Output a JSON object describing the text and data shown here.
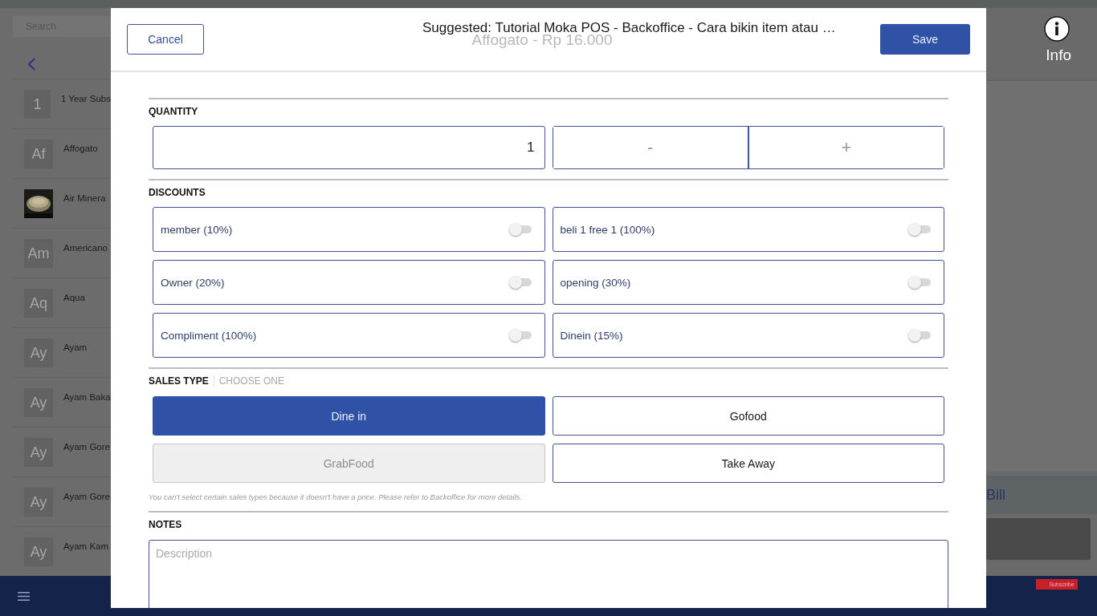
{
  "background_app": {
    "search": {
      "placeholder": "Search"
    },
    "items": [
      {
        "name": "1 Year Subs",
        "kind": "letters",
        "initials": "1"
      },
      {
        "name": "Affogato",
        "kind": "letters",
        "initials": "Af"
      },
      {
        "name": "Air Minera",
        "kind": "picture"
      },
      {
        "name": "Americano",
        "kind": "letters",
        "initials": "Am"
      },
      {
        "name": "Aqua",
        "kind": "letters",
        "initials": "Aq"
      },
      {
        "name": "Ayam",
        "kind": "letters",
        "initials": "Ay"
      },
      {
        "name": "Ayam Baka",
        "kind": "letters",
        "initials": "Ay"
      },
      {
        "name": "Ayam Gore",
        "kind": "letters",
        "initials": "Ay"
      },
      {
        "name": "Ayam Gore",
        "kind": "letters",
        "initials": "Ay"
      },
      {
        "name": "Ayam Kam",
        "kind": "letters",
        "initials": "Ay"
      }
    ],
    "bill_label": "Bill"
  },
  "modal": {
    "title": "Affogato - Rp 16.000",
    "cancel": "Cancel",
    "save": "Save",
    "quantity": {
      "label": "QUANTITY",
      "value": "1",
      "minus": "-",
      "plus": "+"
    },
    "discounts": {
      "label": "DISCOUNTS",
      "items": [
        {
          "name": "member (10%)",
          "on": false
        },
        {
          "name": "beli 1 free 1 (100%)",
          "on": false
        },
        {
          "name": "Owner (20%)",
          "on": false
        },
        {
          "name": "opening (30%)",
          "on": false
        },
        {
          "name": "Compliment (100%)",
          "on": false
        },
        {
          "name": "Dinein (15%)",
          "on": false
        }
      ]
    },
    "sales_type": {
      "label": "SALES TYPE",
      "sublabel": "CHOOSE ONE",
      "options": [
        {
          "label": "Dine in",
          "selected": true,
          "disabled": false
        },
        {
          "label": "Gofood",
          "selected": false,
          "disabled": false
        },
        {
          "label": "GrabFood",
          "selected": false,
          "disabled": true
        },
        {
          "label": "Take Away",
          "selected": false,
          "disabled": false
        }
      ],
      "note": "You can't select certain sales types because it doesn't have a price. Please refer to Backoffice for more details."
    },
    "notes": {
      "label": "NOTES",
      "placeholder": "Description"
    }
  },
  "video_overlay": {
    "suggested": "Suggested: Tutorial Moka POS - Backoffice - Cara bikin item atau …",
    "info": "Info",
    "subscribe": "Subscribe"
  }
}
